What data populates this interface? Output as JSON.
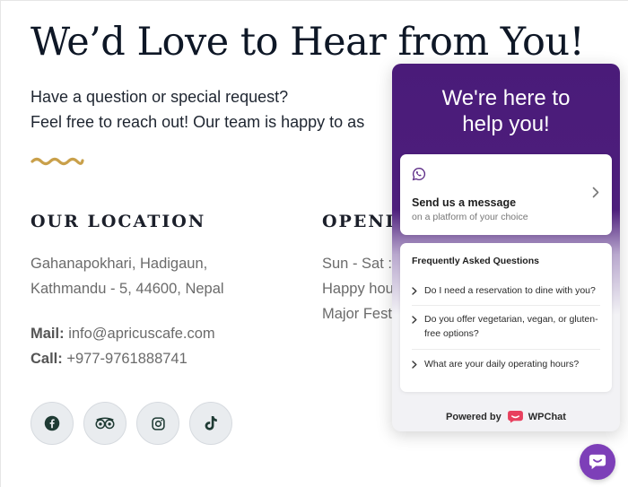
{
  "page": {
    "title": "We’d Love to Hear from You!",
    "intro_line1": "Have a question or special request?",
    "intro_line2": "Feel free to reach out! Our team is happy to as"
  },
  "location": {
    "heading": "OUR LOCATION",
    "address_line1": "Gahanapokhari, Hadigaun,",
    "address_line2": "Kathmandu - 5, 44600, Nepal",
    "mail_label": "Mail:",
    "mail_value": "info@apricuscafe.com",
    "call_label": "Call:",
    "call_value": "+977-9761888741"
  },
  "hours": {
    "heading": "OPENIN",
    "line1": "Sun - Sat :",
    "line2": "Happy hou",
    "line3": "Major Fest"
  },
  "socials": [
    {
      "icon": "facebook-icon"
    },
    {
      "icon": "tripadvisor-icon"
    },
    {
      "icon": "instagram-icon"
    },
    {
      "icon": "tiktok-icon"
    }
  ],
  "widget": {
    "title_line1": "We're here to",
    "title_line2": "help you!",
    "message_title": "Send us a message",
    "message_subtitle": "on a platform of your choice",
    "faq_title": "Frequently Asked Questions",
    "faq_items": [
      "Do I need a reservation to dine with you?",
      "Do you offer vegetarian, vegan, or gluten-free options?",
      "What are your daily operating hours?"
    ],
    "powered_by": "Powered by",
    "brand": "WPChat"
  },
  "colors": {
    "widget_purple": "#4a1b79",
    "accent_gold": "#c9a04a",
    "launcher_purple": "#7d3fb8",
    "whatsapp_icon": "#5b2a86"
  }
}
